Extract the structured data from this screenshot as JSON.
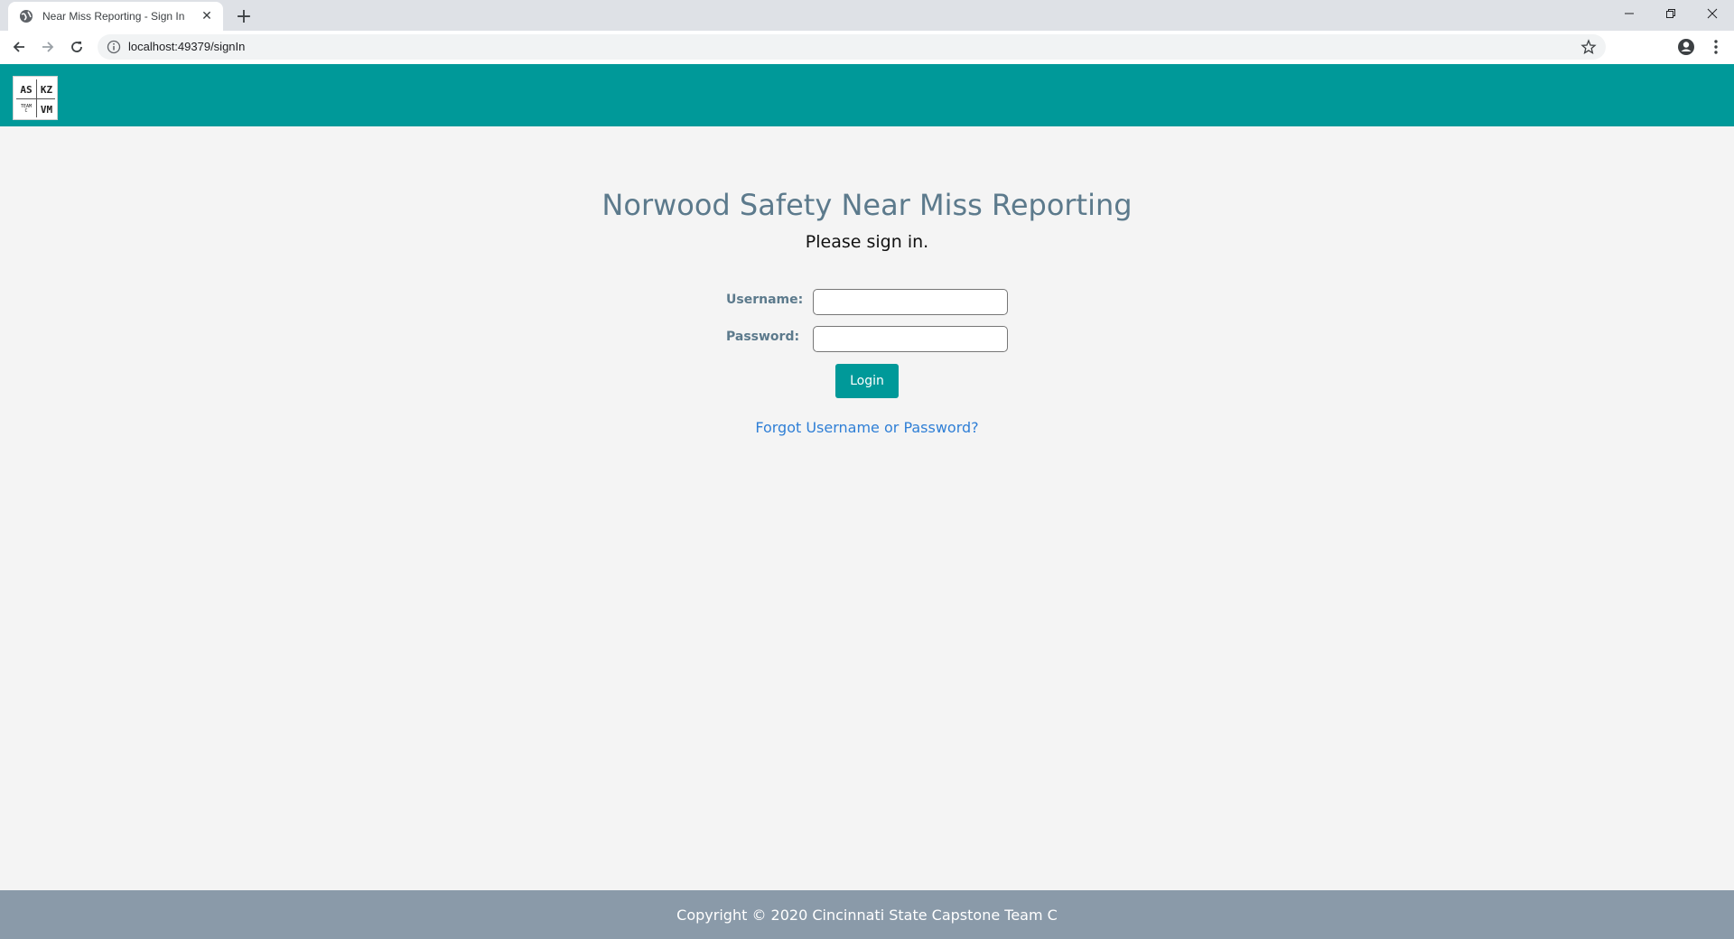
{
  "browser": {
    "tab_title": "Near Miss Reporting - Sign In",
    "new_tab_label": "+",
    "url": "localhost:49379/signIn"
  },
  "header": {
    "logo": {
      "top_left": "AS",
      "top_right": "KZ",
      "bottom_left_line1": "TEAM",
      "bottom_left_line2": "C",
      "bottom_right": "VM"
    },
    "bg_color": "#009999"
  },
  "main": {
    "title": "Norwood Safety Near Miss Reporting",
    "subtitle": "Please sign in.",
    "username_label": "Username:",
    "username_value": "",
    "password_label": "Password:",
    "password_value": "",
    "login_label": "Login",
    "forgot_link": "Forgot Username or Password?"
  },
  "footer": {
    "text": "Copyright © 2020 Cincinnati State Capstone Team C"
  }
}
